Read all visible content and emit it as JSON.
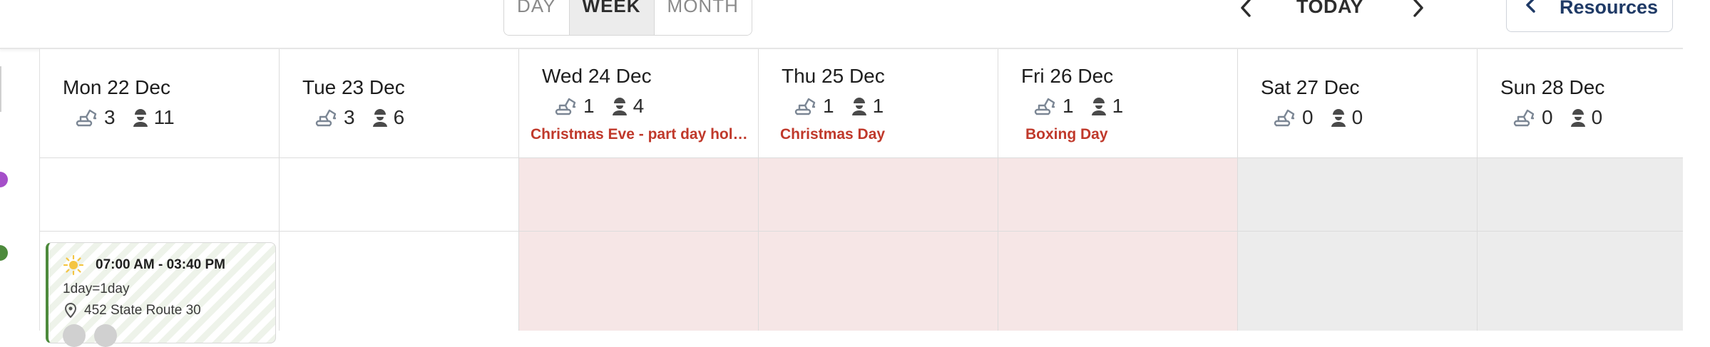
{
  "view_switcher": {
    "day": "DAY",
    "week": "WEEK",
    "month": "MONTH",
    "active": "WEEK"
  },
  "nav": {
    "today": "TODAY",
    "resources": "Resources"
  },
  "days": [
    {
      "title": "Mon 22 Dec",
      "machines": "3",
      "people": "11",
      "holiday": "",
      "shade": "none"
    },
    {
      "title": "Tue 23 Dec",
      "machines": "3",
      "people": "6",
      "holiday": "",
      "shade": "none"
    },
    {
      "title": "Wed 24 Dec",
      "machines": "1",
      "people": "4",
      "holiday": "Christmas Eve - part day hol…",
      "shade": "holiday"
    },
    {
      "title": "Thu 25 Dec",
      "machines": "1",
      "people": "1",
      "holiday": "Christmas Day",
      "shade": "holiday"
    },
    {
      "title": "Fri 26 Dec",
      "machines": "1",
      "people": "1",
      "holiday": "Boxing Day",
      "shade": "holiday"
    },
    {
      "title": "Sat 27 Dec",
      "machines": "0",
      "people": "0",
      "holiday": "",
      "shade": "weekend"
    },
    {
      "title": "Sun 28 Dec",
      "machines": "0",
      "people": "0",
      "holiday": "",
      "shade": "weekend"
    }
  ],
  "rows": [
    {
      "color": "#a54fc9"
    },
    {
      "color": "#4d8a3c"
    }
  ],
  "event": {
    "time": "07:00 AM - 03:40 PM",
    "description": "1day=1day",
    "location": "452 State Route 30"
  },
  "colors": {
    "holiday_text": "#c0392b",
    "holiday_bg": "#f6e6e6",
    "weekend_bg": "#ececec",
    "accent": "#1f3a66"
  },
  "icons": [
    "chevron-left-icon",
    "chevron-right-icon",
    "excavator-icon",
    "worker-icon",
    "sun-icon",
    "location-pin-icon"
  ]
}
